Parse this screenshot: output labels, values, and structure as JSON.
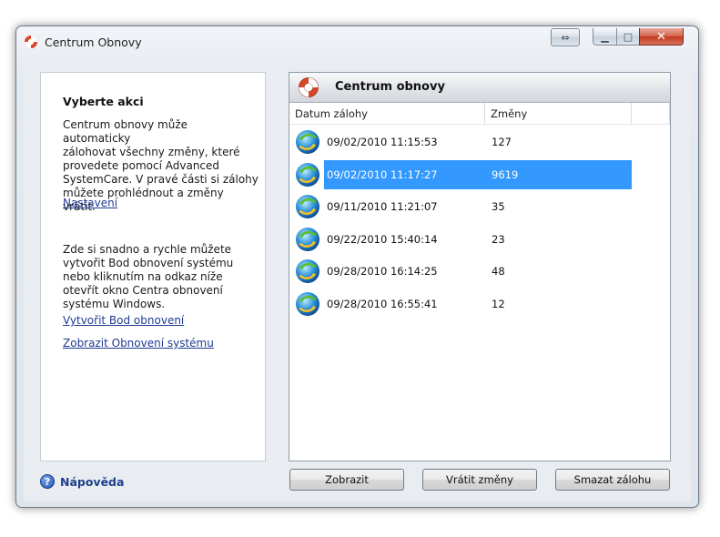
{
  "window": {
    "title": "Centrum Obnovy"
  },
  "left": {
    "heading": "Vyberte akci",
    "paragraph1": [
      "Centrum obnovy může automaticky",
      "zálohovat všechny změny, které",
      "provedete pomocí Advanced",
      "SystemCare. V pravé části si zálohy",
      "můžete prohlédnout a změny vrátit."
    ],
    "link_settings": "Nastavení",
    "paragraph2": [
      "Zde si snadno a rychle můžete",
      "vytvořit Bod obnovení systému",
      "nebo kliknutím na odkaz níže",
      "otevřít okno Centra obnovení",
      "systému Windows."
    ],
    "link_create": "Vytvořit Bod obnovení",
    "link_show": "Zobrazit Obnovení systému"
  },
  "help": {
    "label": "Nápověda"
  },
  "right": {
    "title": "Centrum obnovy",
    "columns": [
      "Datum zálohy",
      "Změny"
    ],
    "rows": [
      {
        "date": "09/02/2010 11:15:53",
        "count": "127",
        "selected": false
      },
      {
        "date": "09/02/2010 11:17:27",
        "count": "9619",
        "selected": true
      },
      {
        "date": "09/11/2010 11:21:07",
        "count": "35",
        "selected": false
      },
      {
        "date": "09/22/2010 15:40:14",
        "count": "23",
        "selected": false
      },
      {
        "date": "09/28/2010 16:14:25",
        "count": "48",
        "selected": false
      },
      {
        "date": "09/28/2010 16:55:41",
        "count": "12",
        "selected": false
      }
    ]
  },
  "buttons": {
    "show": "Zobrazit",
    "revert": "Vrátit změny",
    "delete": "Smazat zálohu"
  },
  "colors": {
    "selection": "#3399ff",
    "link": "#1f3a93"
  }
}
